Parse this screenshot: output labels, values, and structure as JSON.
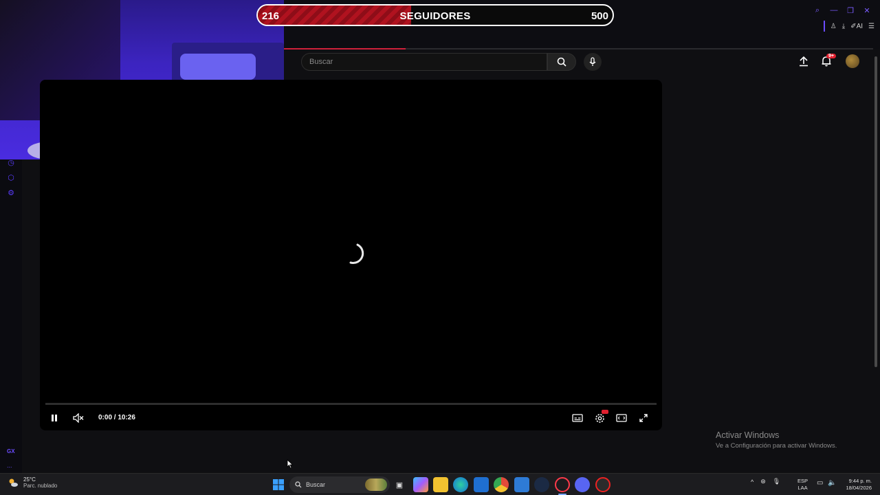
{
  "goal": {
    "current": "216",
    "title": "SEGUIDORES",
    "target": "500",
    "progress": 0.432
  },
  "youtube": {
    "search_placeholder": "Buscar",
    "notif_badge": "9+"
  },
  "player": {
    "time": "0:00 / 10:26"
  },
  "watermark": {
    "line1": "Activar Windows",
    "line2": "Ve a Configuración para activar Windows."
  },
  "sidebar": {
    "gx_label": "GX",
    "more": "..."
  },
  "browser": {
    "ai_label": "AI"
  },
  "taskbar": {
    "weather_temp": "25°C",
    "weather_cond": "Parc. nublado",
    "search_placeholder": "Buscar",
    "lang_line1": "ESP",
    "lang_line2": "LAA",
    "time": "9:44 p. m.",
    "date": "18/04/2026"
  },
  "colors": {
    "accent_red": "#d0213b",
    "gx_purple": "#6b4cff"
  }
}
